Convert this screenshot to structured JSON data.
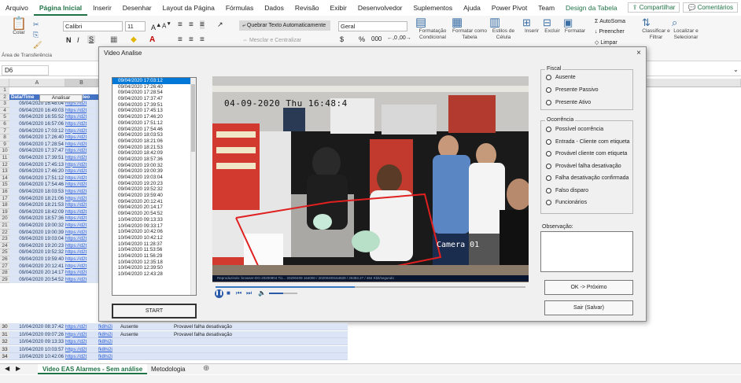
{
  "ribbon": {
    "tabs": [
      "Arquivo",
      "Página Inicial",
      "Inserir",
      "Desenhar",
      "Layout da Página",
      "Fórmulas",
      "Dados",
      "Revisão",
      "Exibir",
      "Desenvolvedor",
      "Suplementos",
      "Ajuda",
      "Power Pivot",
      "Team",
      "Design da Tabela"
    ],
    "active_tab": "Página Inicial",
    "share_label": "Compartilhar",
    "comments_label": "Comentários",
    "font_name": "Calibri",
    "font_size": "11",
    "number_format": "Geral",
    "paste_label": "Colar",
    "clipboard_caption": "Área de Transferência",
    "wrap_label": "Quebrar Texto Automaticamente",
    "merge_label": "Mesclar e Centralizar",
    "cond_format_label": "Formatação Condicional",
    "format_table_label": "Formatar como Tabela",
    "cell_styles_label": "Estilos de Célula",
    "insert_label": "Inserir",
    "delete_label": "Excluir",
    "format_label": "Formatar",
    "autosum_label": "AutoSoma",
    "fill_label": "Preencher",
    "clear_label": "Limpar",
    "sort_label": "Classificar e Filtrar",
    "find_label": "Localizar e Selecionar"
  },
  "formula_bar": {
    "name_box": "D6"
  },
  "sheet": {
    "col_headers": [
      "A",
      "B"
    ],
    "filter_button": "Analisar",
    "header_row": {
      "a": "Data/Time",
      "b": "Link Video"
    },
    "rows": [
      {
        "n": "1",
        "a": "",
        "b": ""
      },
      {
        "n": "2",
        "a": "Data/Time",
        "b": "Link Video"
      },
      {
        "n": "3",
        "a": "09/04/2020 16:48:04",
        "b": "https://d2t"
      },
      {
        "n": "4",
        "a": "09/04/2020 16:49:03",
        "b": "https://d2t"
      },
      {
        "n": "5",
        "a": "09/04/2020 16:55:52",
        "b": "https://d2t"
      },
      {
        "n": "6",
        "a": "09/04/2020 16:57:06",
        "b": "https://d2t"
      },
      {
        "n": "7",
        "a": "09/04/2020 17:03:12",
        "b": "https://d2t"
      },
      {
        "n": "8",
        "a": "09/04/2020 17:26:40",
        "b": "https://d2t"
      },
      {
        "n": "9",
        "a": "09/04/2020 17:28:54",
        "b": "https://d2t"
      },
      {
        "n": "10",
        "a": "09/04/2020 17:37:47",
        "b": "https://d2t"
      },
      {
        "n": "11",
        "a": "09/04/2020 17:39:51",
        "b": "https://d2t"
      },
      {
        "n": "12",
        "a": "09/04/2020 17:45:13",
        "b": "https://d2t"
      },
      {
        "n": "13",
        "a": "09/04/2020 17:46:20",
        "b": "https://d2t"
      },
      {
        "n": "14",
        "a": "09/04/2020 17:51:12",
        "b": "https://d2t"
      },
      {
        "n": "15",
        "a": "09/04/2020 17:54:46",
        "b": "https://d2t"
      },
      {
        "n": "16",
        "a": "09/04/2020 18:03:53",
        "b": "https://d2t"
      },
      {
        "n": "17",
        "a": "09/04/2020 18:21:06",
        "b": "https://d2t"
      },
      {
        "n": "18",
        "a": "09/04/2020 18:21:53",
        "b": "https://d2t"
      },
      {
        "n": "19",
        "a": "09/04/2020 18:42:09",
        "b": "https://d2t"
      },
      {
        "n": "20",
        "a": "09/04/2020 18:57:36",
        "b": "https://d2t"
      },
      {
        "n": "21",
        "a": "09/04/2020 19:00:32",
        "b": "https://d2t"
      },
      {
        "n": "22",
        "a": "09/04/2020 19:00:39",
        "b": "https://d2t"
      },
      {
        "n": "23",
        "a": "09/04/2020 19:03:04",
        "b": "https://d2t"
      },
      {
        "n": "24",
        "a": "09/04/2020 19:20:23",
        "b": "https://d2t"
      },
      {
        "n": "25",
        "a": "09/04/2020 19:52:32",
        "b": "https://d2t"
      },
      {
        "n": "26",
        "a": "09/04/2020 19:59:40",
        "b": "https://d2t"
      },
      {
        "n": "27",
        "a": "09/04/2020 20:12:41",
        "b": "https://d2t"
      },
      {
        "n": "28",
        "a": "09/04/2020 20:14:17",
        "b": "https://d2t"
      },
      {
        "n": "29",
        "a": "09/04/2020 20:54:52",
        "b": "https://d2t"
      }
    ],
    "lower_rows": [
      {
        "n": "30",
        "a": "10/04/2020 08:37:42",
        "b": "https://d2t",
        "link": "fk8hi2i",
        "presence": "Ausente",
        "occurrence": "Provavel falha desativação"
      },
      {
        "n": "31",
        "a": "10/04/2020 09:07:26",
        "b": "https://d2t",
        "link": "fk8hi2i",
        "presence": "Ausente",
        "occurrence": "Provavel falha desativação"
      },
      {
        "n": "32",
        "a": "10/04/2020 09:13:33",
        "b": "https://d2t",
        "link": "fk8hi2i",
        "presence": "",
        "occurrence": ""
      },
      {
        "n": "33",
        "a": "10/04/2020 10:03:57",
        "b": "https://d2t",
        "link": "fk8hi2i",
        "presence": "",
        "occurrence": ""
      },
      {
        "n": "34",
        "a": "10/04/2020 10:42:06",
        "b": "https://d2t",
        "link": "fk8hi2i",
        "presence": "",
        "occurrence": ""
      }
    ],
    "tabs": [
      "Video EAS Alarmes - Sem análise",
      "Metodologia"
    ],
    "active_sheet": "Video EAS Alarmes - Sem análise"
  },
  "dialog": {
    "title": "Video Analise",
    "close_glyph": "×",
    "list_items": [
      "09/04/2020 17:03:12",
      "09/04/2020 17:26:40",
      "09/04/2020 17:28:54",
      "09/04/2020 17:37:47",
      "09/04/2020 17:39:51",
      "09/04/2020 17:45:13",
      "09/04/2020 17:46:20",
      "09/04/2020 17:51:12",
      "09/04/2020 17:54:46",
      "09/04/2020 18:03:53",
      "09/04/2020 18:21:06",
      "09/04/2020 18:21:53",
      "09/04/2020 18:42:09",
      "09/04/2020 18:57:36",
      "09/04/2020 19:00:32",
      "09/04/2020 19:00:39",
      "09/04/2020 19:03:04",
      "09/04/2020 19:20:23",
      "09/04/2020 19:52:32",
      "09/04/2020 19:59:40",
      "09/04/2020 20:12:41",
      "09/04/2020 20:14:17",
      "09/04/2020 20:54:52",
      "10/04/2020 09:13:33",
      "10/04/2020 09:33:17",
      "10/04/2020 10:42:06",
      "10/04/2020 10:42:12",
      "10/04/2020 11:28:37",
      "10/04/2020 11:53:56",
      "10/04/2020 11:56:29",
      "10/04/2020 12:35:18",
      "10/04/2020 12:39:50",
      "10/04/2020 12:43:28"
    ],
    "selected_index": 0,
    "start_label": "START",
    "video": {
      "timestamp": "04-09-2020 Thu 16:48:4",
      "camera_label": "Camera 01",
      "info_line": "Reproduzindo: browser-DG-20200904 Ti1... 20200409 164000 / 20200409164828 / 25383.27 / 484 Kbit/segundo",
      "progress": 0.45,
      "volume": 0.5
    },
    "presence": {
      "legend": "Fiscal",
      "options": [
        "Ausente",
        "Presente Passivo",
        "Presente Ativo"
      ]
    },
    "occurrence": {
      "legend": "Ocorrência",
      "options": [
        "Possível ocorrência",
        "Entrada - Cliente com etiqueta",
        "Provável cliente com etiqueta",
        "Provável falha desativação",
        "Falha desativação confirmada",
        "Falso disparo",
        "Funcionários"
      ]
    },
    "observation_label": "Observação:",
    "observation_value": "",
    "ok_label": "OK -> Próximo",
    "exit_label": "Sair (Salvar)"
  }
}
